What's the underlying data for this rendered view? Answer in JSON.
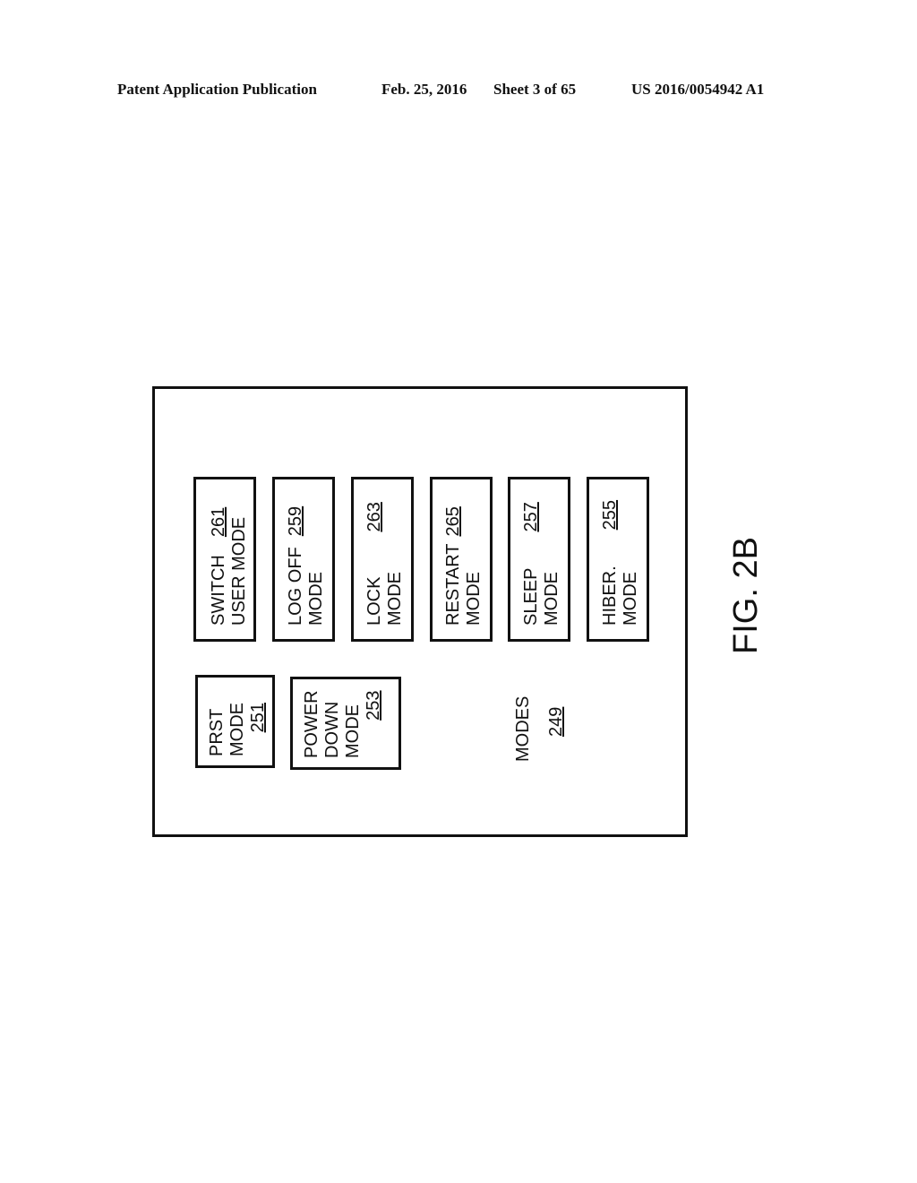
{
  "header": {
    "left": "Patent Application Publication",
    "date": "Feb. 25, 2016",
    "sheet": "Sheet 3 of 65",
    "pub_number": "US 2016/0054942 A1"
  },
  "figure": {
    "label": "FIG. 2B",
    "container": {
      "title": "MODES",
      "ref": "249"
    },
    "top_row": [
      {
        "line1": "SWITCH",
        "line2": "USER MODE",
        "ref": "261"
      },
      {
        "line1": "LOG OFF",
        "line2": "MODE",
        "ref": "259"
      },
      {
        "line1": "LOCK",
        "line2": "MODE",
        "ref": "263"
      },
      {
        "line1": "RESTART",
        "line2": "MODE",
        "ref": "265"
      },
      {
        "line1": "SLEEP",
        "line2": "MODE",
        "ref": "257"
      },
      {
        "line1": "HIBER.",
        "line2": "MODE",
        "ref": "255"
      }
    ],
    "bottom_row": [
      {
        "lines": [
          "PRST",
          "MODE"
        ],
        "ref": "251"
      },
      {
        "lines": [
          "POWER",
          "DOWN",
          "MODE"
        ],
        "ref": "253"
      }
    ]
  }
}
